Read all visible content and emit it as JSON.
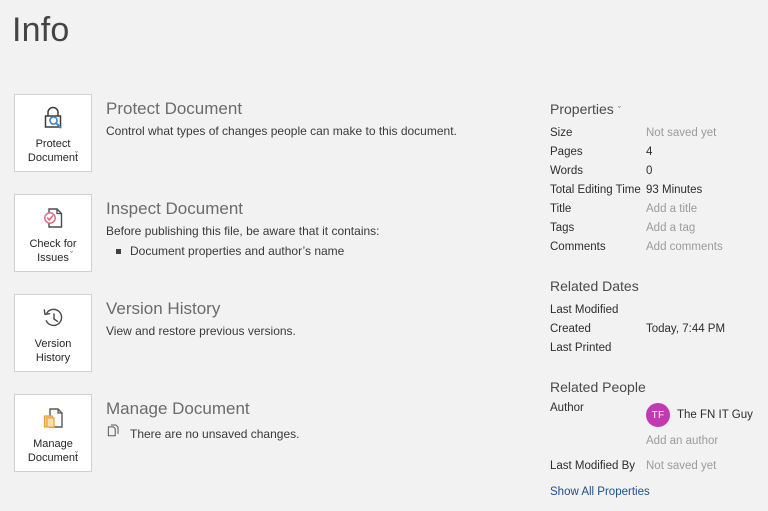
{
  "page": {
    "title": "Info"
  },
  "blocks": [
    {
      "tile_label": "Protect\nDocument",
      "tile_icon": "lock-search-icon",
      "has_chevron": true,
      "chevron": "ˇ",
      "title": "Protect Document",
      "desc": "Control what types of changes people can make to this document."
    },
    {
      "tile_label": "Check for\nIssues",
      "tile_icon": "document-check-icon",
      "has_chevron": true,
      "chevron": "ˇ",
      "title": "Inspect Document",
      "desc": "Before publishing this file, be aware that it contains:",
      "bullets": [
        "Document properties and author’s name"
      ]
    },
    {
      "tile_label": "Version\nHistory",
      "tile_icon": "clock-history-icon",
      "has_chevron": false,
      "chevron": "",
      "title": "Version History",
      "desc": "View and restore previous versions."
    },
    {
      "tile_label": "Manage\nDocument",
      "tile_icon": "document-pages-icon",
      "has_chevron": true,
      "chevron": "ˇ",
      "title": "Manage Document",
      "note_icon": "unsaved-copy-icon",
      "note": "There are no unsaved changes."
    }
  ],
  "properties": {
    "heading": "Properties",
    "chevron": "ˇ",
    "rows": [
      {
        "name": "Size",
        "value": "Not saved yet",
        "placeholder": true
      },
      {
        "name": "Pages",
        "value": "4",
        "placeholder": false
      },
      {
        "name": "Words",
        "value": "0",
        "placeholder": false
      },
      {
        "name": "Total Editing Time",
        "value": "93 Minutes",
        "placeholder": false
      },
      {
        "name": "Title",
        "value": "Add a title",
        "placeholder": true
      },
      {
        "name": "Tags",
        "value": "Add a tag",
        "placeholder": true
      },
      {
        "name": "Comments",
        "value": "Add comments",
        "placeholder": true
      }
    ]
  },
  "related_dates": {
    "heading": "Related Dates",
    "rows": [
      {
        "name": "Last Modified",
        "value": "",
        "placeholder": false
      },
      {
        "name": "Created",
        "value": "Today, 7:44 PM",
        "placeholder": false
      },
      {
        "name": "Last Printed",
        "value": "",
        "placeholder": false
      }
    ]
  },
  "related_people": {
    "heading": "Related People",
    "author_label": "Author",
    "author_initials": "TF",
    "author_name": "The FN IT Guy",
    "add_author": "Add an author",
    "last_modified_by_label": "Last Modified By",
    "last_modified_by_value": "Not saved yet"
  },
  "footer": {
    "show_all_properties": "Show All Properties"
  },
  "colors": {
    "background": "#f2f2f2",
    "avatar": "#c239b3",
    "link": "#1f4e8c",
    "heading": "#6b6b6b",
    "accent_blue": "#3f87c7",
    "accent_red": "#e0647a",
    "accent_orange": "#e8a33d"
  }
}
